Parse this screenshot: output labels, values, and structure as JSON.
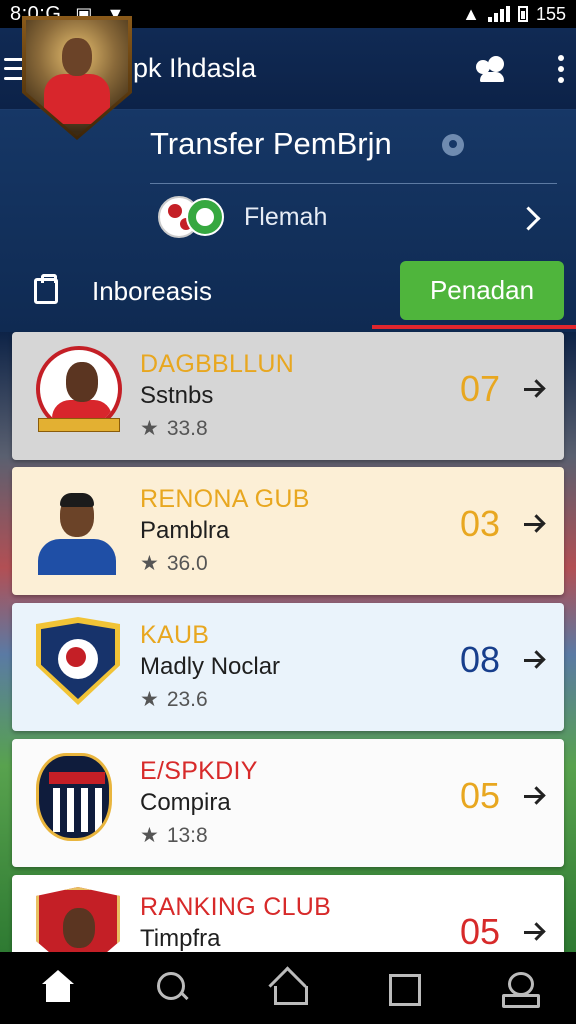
{
  "status_bar": {
    "time": "8:0:G",
    "battery": "155"
  },
  "app_bar": {
    "title": "Sepk Ihdasla"
  },
  "header": {
    "title": "Transfer PemBrjn",
    "league": "Flemah",
    "country": "Inboreasis",
    "primary_button": "Penadan"
  },
  "list": [
    {
      "title": "DAGBBLLUN",
      "subtitle": "Sstnbs",
      "rating": "33.8",
      "number": "07",
      "color": "#e8a720"
    },
    {
      "title": "RENONA GUB",
      "subtitle": "Pamblra",
      "rating": "36.0",
      "number": "03",
      "color": "#e8a720"
    },
    {
      "title": "KAUB",
      "subtitle": "Madly Noclar",
      "rating": "23.6",
      "number": "08",
      "color": "#173e8c"
    },
    {
      "title": "E/SPKDIY",
      "subtitle": "Compira",
      "rating": "13:8",
      "number": "05",
      "color": "#d72a2a"
    },
    {
      "title": "RANKING CLUB",
      "subtitle": "Timpfra",
      "rating": "",
      "number": "05",
      "color": "#d72a2a"
    }
  ],
  "colors": {
    "primary_button": "#4fb53c",
    "app_bar": "#102a54",
    "accent_underline": "#e0262d"
  },
  "bottom_nav": [
    "home-icon",
    "search-icon",
    "home-outline-icon",
    "square-icon",
    "profile-icon"
  ]
}
